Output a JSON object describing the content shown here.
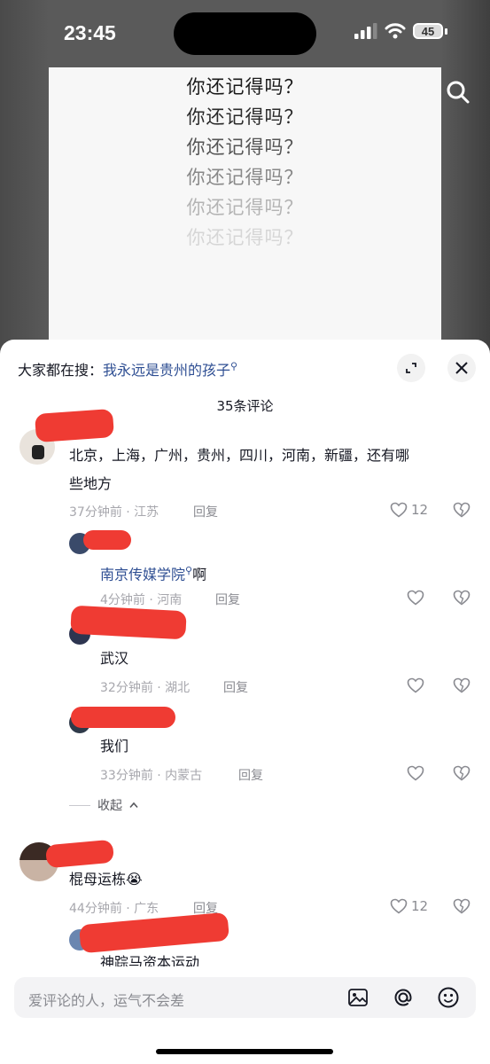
{
  "status": {
    "time": "23:45",
    "battery": "45"
  },
  "video": {
    "lines": [
      "你还记得吗？",
      "你还记得吗？",
      "你还记得吗？",
      "你还记得吗？",
      "你还记得吗？",
      "你还记得吗？"
    ]
  },
  "sheet": {
    "suggest_prefix": "大家都在搜：",
    "suggest_link": "我永远是贵州的孩子",
    "comment_count": "35条评论"
  },
  "comments": [
    {
      "text": "北京，上海，广州，贵州，四川，河南，新疆，还有哪",
      "text2": "些地方",
      "meta": "37分钟前 · 江苏",
      "reply": "回复",
      "likes": "12"
    },
    {
      "link": "南京传媒学院",
      "suffix": "啊",
      "meta": "4分钟前 · 河南",
      "reply": "回复"
    },
    {
      "text": "武汉",
      "meta": "32分钟前 · 湖北",
      "reply": "回复"
    },
    {
      "text": "我们",
      "meta": "33分钟前 · 内蒙古",
      "reply": "回复"
    },
    {
      "text": "棍母运栋😭",
      "meta": "44分钟前 · 广东",
      "reply": "回复",
      "likes": "12"
    },
    {
      "text": "神踪马资本运动"
    }
  ],
  "collapse": "收起",
  "input": {
    "placeholder": "爱评论的人，运气不会差"
  }
}
